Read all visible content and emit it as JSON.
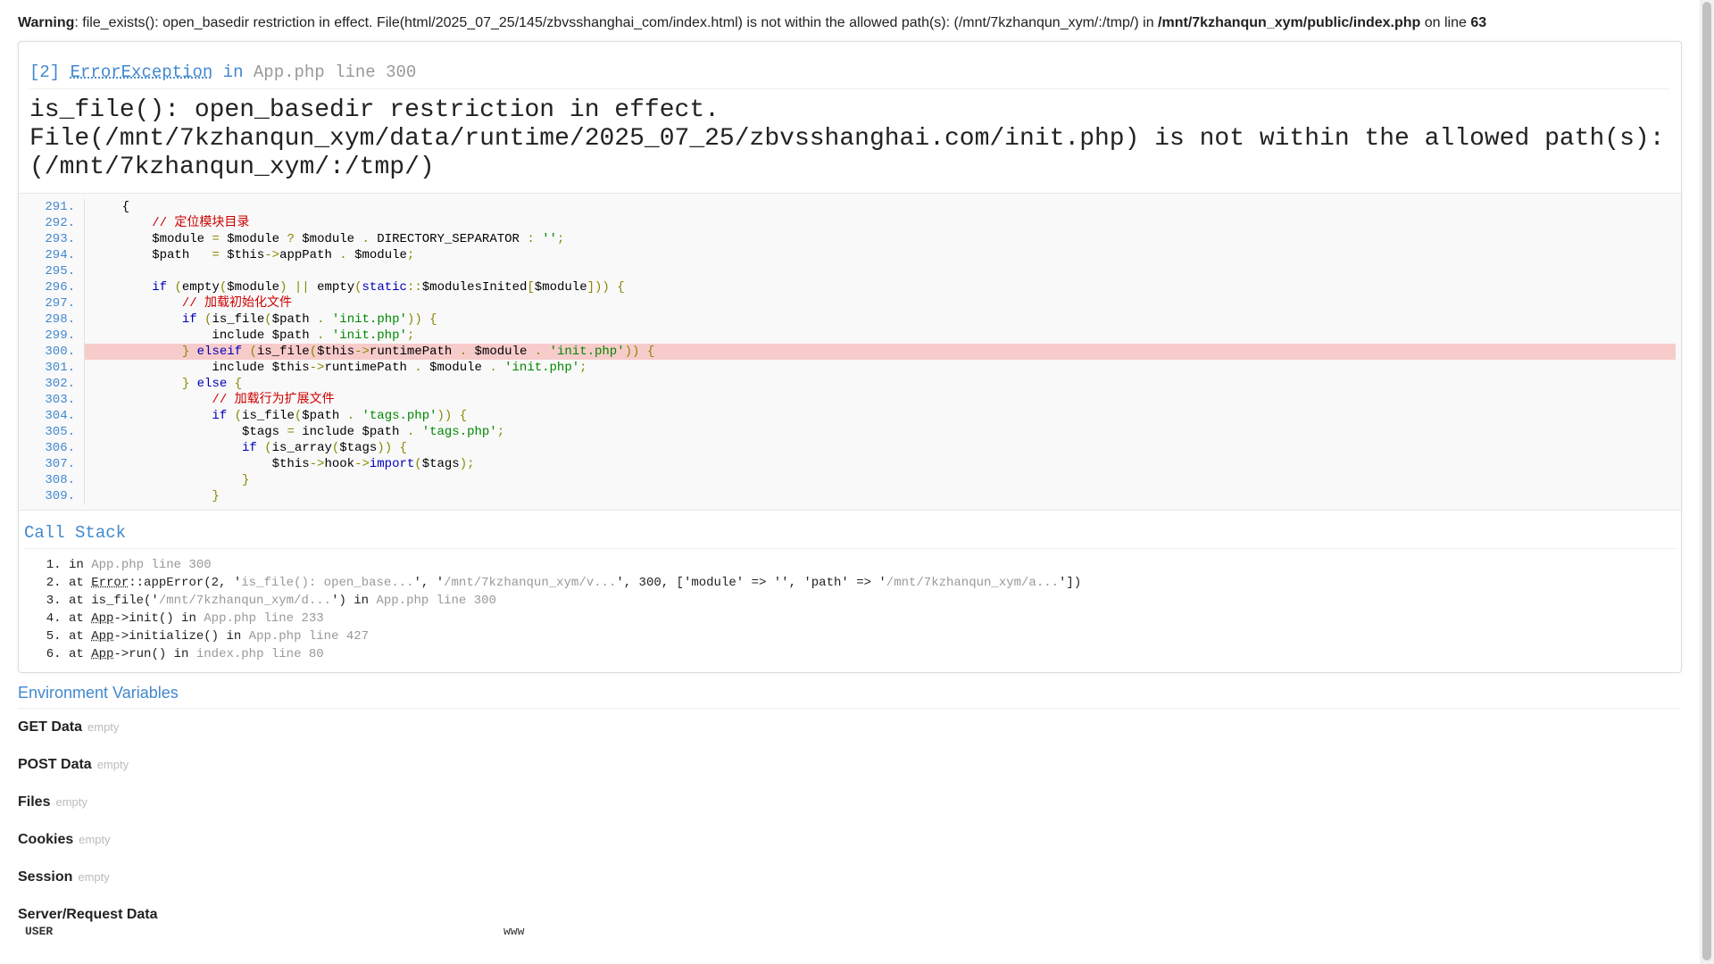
{
  "warning": {
    "label": "Warning",
    "text": ": file_exists(): open_basedir restriction in effect. File(html/2025_07_25/145/zbvsshanghai_com/index.html) is not within the allowed path(s): (/mnt/7kzhanqun_xym/:/tmp/) in ",
    "file": "/mnt/7kzhanqun_xym/public/index.php",
    "on_line": " on line ",
    "line": "63"
  },
  "exception": {
    "code": "[2]",
    "class": "ErrorException",
    "in_word": "in",
    "fileref": "App.php line 300",
    "message": "is_file(): open_basedir restriction in effect. File(/mnt/7kzhanqun_xym/data/runtime/2025_07_25/zbvsshanghai.com/init.php) is not within the allowed path(s): (/mnt/7kzhanqun_xym/:/tmp/)"
  },
  "source": {
    "highlight_line": "300."
  },
  "call_stack": {
    "title": "Call Stack",
    "items": [
      {
        "pre": "in ",
        "gray": "App.php line 300"
      },
      {
        "pre": "at ",
        "cls": "Error",
        "mid": "::appError(2, '",
        "g1": "is_file(): open_base...",
        "mid2": "', '",
        "g2": "/mnt/7kzhanqun_xym/v...",
        "mid3": "', 300, ['module' => '', 'path' => '",
        "g3": "/mnt/7kzhanqun_xym/a...",
        "end": "'])"
      },
      {
        "pre": "at is_file('",
        "g1": "/mnt/7kzhanqun_xym/d...",
        "mid": "') in ",
        "gray": "App.php line 300"
      },
      {
        "pre": "at ",
        "cls": "App",
        "mid": "->init() in ",
        "gray": "App.php line 233"
      },
      {
        "pre": "at ",
        "cls": "App",
        "mid": "->initialize() in ",
        "gray": "App.php line 427"
      },
      {
        "pre": "at ",
        "cls": "App",
        "mid": "->run() in ",
        "gray": "index.php line 80"
      }
    ]
  },
  "env": {
    "title": "Environment Variables",
    "sections": [
      {
        "label": "GET Data",
        "value": "empty"
      },
      {
        "label": "POST Data",
        "value": "empty"
      },
      {
        "label": "Files",
        "value": "empty"
      },
      {
        "label": "Cookies",
        "value": "empty"
      },
      {
        "label": "Session",
        "value": "empty"
      }
    ],
    "server_title": "Server/Request Data",
    "server_rows": [
      {
        "key": "USER",
        "value": "www"
      }
    ]
  }
}
